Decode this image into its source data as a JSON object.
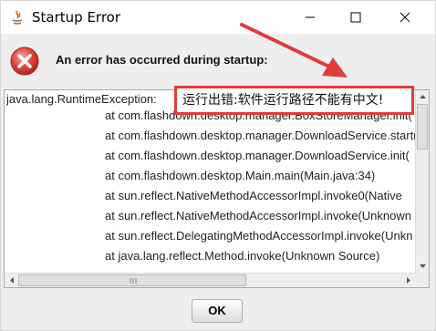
{
  "window": {
    "title": "Startup Error",
    "headline": "An error has occurred during startup:"
  },
  "error_text": {
    "first_line_prefix": "java.lang.RuntimeException:",
    "highlighted_message": "运行出错:软件运行路径不能有中文!",
    "stack_lines": [
      "at com.flashdown.desktop.manager.BoxStoreManager.init(",
      "at com.flashdown.desktop.manager.DownloadService.start(",
      "at com.flashdown.desktop.manager.DownloadService.init(",
      "at com.flashdown.desktop.Main.main(Main.java:34)",
      "at sun.reflect.NativeMethodAccessorImpl.invoke0(Native",
      "at sun.reflect.NativeMethodAccessorImpl.invoke(Unknown",
      "at sun.reflect.DelegatingMethodAccessorImpl.invoke(Unkn",
      "at java.lang.reflect.Method.invoke(Unknown Source)"
    ]
  },
  "buttons": {
    "ok_label": "OK"
  },
  "icons": {
    "app": "java-app-icon",
    "error": "error-x-icon",
    "minimize": "minimize-icon",
    "maximize": "maximize-icon",
    "close": "close-icon"
  },
  "colors": {
    "annotation_red": "#e23b3b",
    "error_red": "#d0312d"
  }
}
